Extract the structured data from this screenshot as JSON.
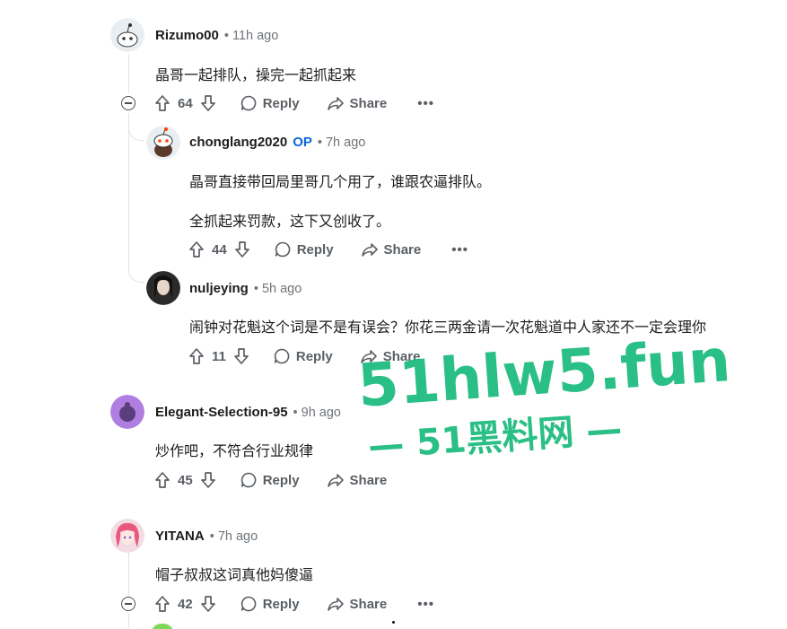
{
  "comments": [
    {
      "author": "Rizumo00",
      "time": "• 11h ago",
      "body": [
        "晶哥一起排队，操完一起抓起来"
      ],
      "votes": "64",
      "reply_label": "Reply",
      "share_label": "Share",
      "avatar_color": "#e9eef2"
    },
    {
      "author": "chonglang2020",
      "op": "OP",
      "time": "• 7h ago",
      "body": [
        "晶哥直接带回局里哥几个用了，谁跟农逼排队。",
        "全抓起来罚款，这下又创收了。"
      ],
      "votes": "44",
      "reply_label": "Reply",
      "share_label": "Share",
      "avatar_color": "#e9eef2"
    },
    {
      "author": "nuljeying",
      "time": "• 5h ago",
      "body": [
        "闹钟对花魁这个词是不是有误会？你花三两金请一次花魁道中人家还不一定会理你"
      ],
      "votes": "11",
      "reply_label": "Reply",
      "share_label": "Share",
      "avatar_color": "#2a2a2a"
    },
    {
      "author": "Elegant-Selection-95",
      "time": "• 9h ago",
      "body": [
        "炒作吧，不符合行业规律"
      ],
      "votes": "45",
      "reply_label": "Reply",
      "share_label": "Share",
      "avatar_color": "#b07de0"
    },
    {
      "author": "YITANA",
      "time": "• 7h ago",
      "body": [
        "帽子叔叔这词真他妈傻逼"
      ],
      "votes": "42",
      "reply_label": "Reply",
      "share_label": "Share",
      "avatar_color": "#f3b7c9"
    }
  ],
  "more_label": "•••",
  "watermark": {
    "line1": "51hlw5.fun",
    "line2": "— 51黑料网 —"
  },
  "colors": {
    "accent_op": "#0a66d6",
    "watermark": "#1aba7d",
    "thread_line": "#e0e3e6"
  }
}
